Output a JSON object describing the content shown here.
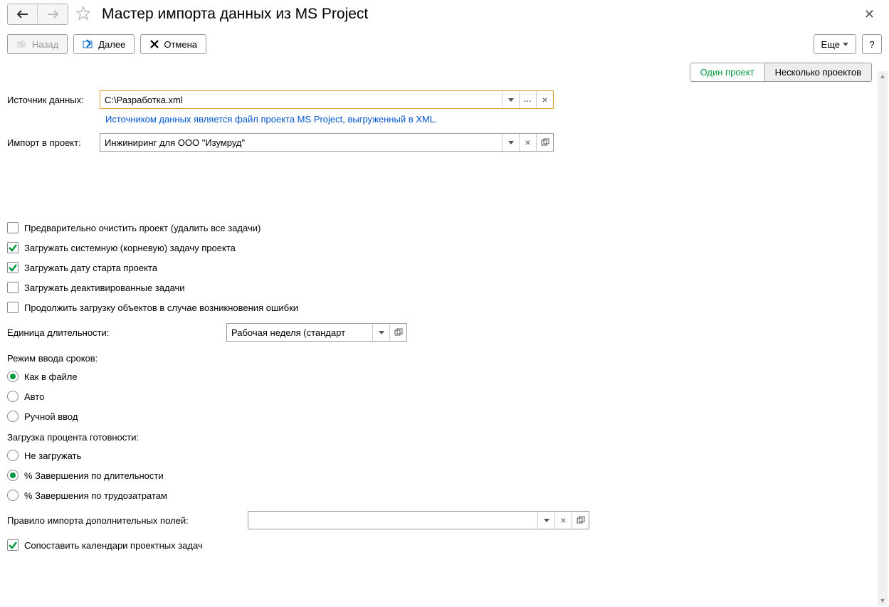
{
  "header": {
    "title": "Мастер импорта данных из MS Project"
  },
  "toolbar": {
    "back": "Назад",
    "next": "Далее",
    "cancel": "Отмена",
    "more": "Еще",
    "help": "?"
  },
  "tabs": {
    "single": "Один проект",
    "multiple": "Несколько проектов"
  },
  "fields": {
    "source_label": "Источник данных:",
    "source_value": "C:\\Разработка.xml",
    "source_hint": "Источником данных является файл проекта MS Project, выгруженный в XML.",
    "project_label": "Импорт в проект:",
    "project_value": "Инжиниринг для ООО \"Изумруд\"",
    "duration_unit_label": "Единица длительности:",
    "duration_unit_value": "Рабочая неделя (стандарт",
    "rule_label": "Правило импорта дополнительных полей:",
    "rule_value": ""
  },
  "checks": {
    "clear_project": "Предварительно очистить проект (удалить все задачи)",
    "load_root": "Загружать системную (корневую) задачу проекта",
    "load_start": "Загружать дату старта проекта",
    "load_deactivated": "Загружать деактивированные задачи",
    "continue_on_error": "Продолжить загрузку объектов в случае возникновения ошибки",
    "match_calendars": "Сопоставить календари проектных задач"
  },
  "groups": {
    "dates_mode": "Режим ввода сроков:",
    "dates_opt1": "Как в файле",
    "dates_opt2": "Авто",
    "dates_opt3": "Ручной ввод",
    "pct_mode": "Загрузка процента готовности:",
    "pct_opt1": "Не загружать",
    "pct_opt2": "% Завершения по длительности",
    "pct_opt3": "% Завершения по трудозатратам"
  }
}
